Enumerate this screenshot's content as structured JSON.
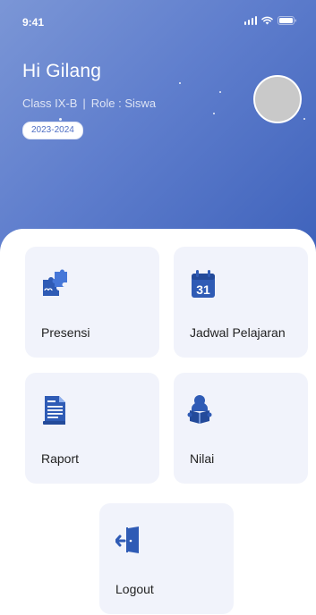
{
  "status_bar": {
    "time": "9:41",
    "icons": [
      "signal-icon",
      "wifi-icon",
      "battery-icon"
    ]
  },
  "profile": {
    "greeting": "Hi Gilang",
    "class_text": "Class IX-B",
    "separator": "|",
    "role_text": "Role : Siswa",
    "year": "2023-2024"
  },
  "menu": {
    "presensi": {
      "label": "Presensi",
      "icon": "puzzle-icon"
    },
    "jadwal": {
      "label": "Jadwal Pelajaran",
      "icon": "calendar-icon",
      "calendar_day": "31"
    },
    "raport": {
      "label": "Raport",
      "icon": "report-document-icon"
    },
    "nilai": {
      "label": "Nilai",
      "icon": "student-reading-icon"
    },
    "logout": {
      "label": "Logout",
      "icon": "logout-door-icon"
    }
  },
  "colors": {
    "header_gradient_start": "#7b96d6",
    "header_gradient_end": "#3e62bb",
    "icon_blue": "#2f5bb5",
    "card_background": "#f1f3fb"
  }
}
